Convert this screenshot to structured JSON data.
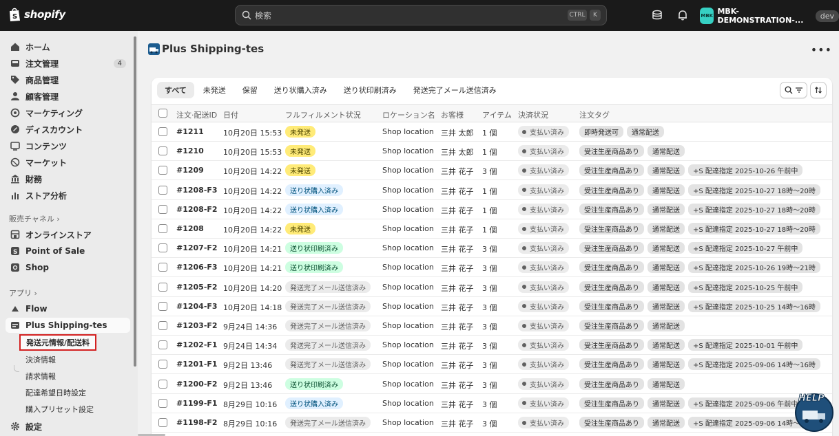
{
  "topbar": {
    "brand": "shopify",
    "search_placeholder": "検索",
    "kbd_ctrl": "CTRL",
    "kbd_k": "K",
    "store_avatar": "MBK",
    "store_name": "MBK-DEMONSTRATION-...",
    "env_badge": "dev"
  },
  "sidebar": {
    "main_items": [
      {
        "label": "ホーム",
        "icon": "home-icon"
      },
      {
        "label": "注文管理",
        "icon": "inbox-icon",
        "badge": "4"
      },
      {
        "label": "商品管理",
        "icon": "tag-icon"
      },
      {
        "label": "顧客管理",
        "icon": "person-icon"
      },
      {
        "label": "マーケティング",
        "icon": "target-icon"
      },
      {
        "label": "ディスカウント",
        "icon": "discount-icon"
      },
      {
        "label": "コンテンツ",
        "icon": "content-icon"
      },
      {
        "label": "マーケット",
        "icon": "globe-icon"
      },
      {
        "label": "財務",
        "icon": "bank-icon"
      },
      {
        "label": "ストア分析",
        "icon": "chart-icon"
      }
    ],
    "sales_channel_label": "販売チャネル",
    "channels": [
      {
        "label": "オンラインストア",
        "icon": "store-icon"
      },
      {
        "label": "Point of Sale",
        "icon": "pos-icon"
      },
      {
        "label": "Shop",
        "icon": "shop-icon"
      }
    ],
    "apps_label": "アプリ",
    "apps": [
      {
        "label": "Flow",
        "icon": "flow-icon"
      },
      {
        "label": "Plus Shipping-tes",
        "icon": "app-icon"
      }
    ],
    "app_sub_items": [
      "発送元情報/配送料",
      "決済情報",
      "請求情報",
      "配達希望日時設定",
      "購入プリセット設定"
    ],
    "settings_label": "設定"
  },
  "page": {
    "title": "Plus Shipping-tes",
    "more": "•••"
  },
  "tabs": [
    "すべて",
    "未発送",
    "保留",
    "送り状購入済み",
    "送り状印刷済み",
    "発送完了メール送信済み"
  ],
  "columns": [
    "注文·配送ID",
    "日付",
    "フルフィルメント状況",
    "ロケーション名",
    "お客様",
    "アイテム",
    "決済状況",
    "注文タグ"
  ],
  "colors": {
    "yellow": "#ffeb78",
    "blue": "#e0f0ff",
    "green": "#cdfee1",
    "gray": "#ebebeb"
  },
  "rows": [
    {
      "id": "#1211",
      "date": "10月20日 15:53",
      "status": "未発送",
      "status_type": "yellow",
      "location": "Shop location",
      "customer": "三井 太郎",
      "items": "1 個",
      "payment": "支払い済み",
      "tags": [
        "即時発送可",
        "通常配送"
      ]
    },
    {
      "id": "#1210",
      "date": "10月20日 15:53",
      "status": "未発送",
      "status_type": "yellow",
      "location": "Shop location",
      "customer": "三井 太郎",
      "items": "1 個",
      "payment": "支払い済み",
      "tags": [
        "受注生産商品あり",
        "通常配送"
      ]
    },
    {
      "id": "#1209",
      "date": "10月20日 14:22",
      "status": "未発送",
      "status_type": "yellow",
      "location": "Shop location",
      "customer": "三井 花子",
      "items": "3 個",
      "payment": "支払い済み",
      "tags": [
        "受注生産商品あり",
        "通常配送",
        "+S 配達指定 2025-10-26 午前中"
      ]
    },
    {
      "id": "#1208-F3",
      "date": "10月20日 14:22",
      "status": "送り状購入済み",
      "status_type": "blue",
      "location": "Shop location",
      "customer": "三井 花子",
      "items": "1 個",
      "payment": "支払い済み",
      "tags": [
        "受注生産商品あり",
        "通常配送",
        "+S 配達指定 2025-10-27 18時〜20時"
      ]
    },
    {
      "id": "#1208-F2",
      "date": "10月20日 14:22",
      "status": "送り状購入済み",
      "status_type": "blue",
      "location": "Shop location",
      "customer": "三井 花子",
      "items": "1 個",
      "payment": "支払い済み",
      "tags": [
        "受注生産商品あり",
        "通常配送",
        "+S 配達指定 2025-10-27 18時〜20時"
      ]
    },
    {
      "id": "#1208",
      "date": "10月20日 14:22",
      "status": "未発送",
      "status_type": "yellow",
      "location": "Shop location",
      "customer": "三井 花子",
      "items": "1 個",
      "payment": "支払い済み",
      "tags": [
        "受注生産商品あり",
        "通常配送",
        "+S 配達指定 2025-10-27 18時〜20時"
      ]
    },
    {
      "id": "#1207-F2",
      "date": "10月20日 14:21",
      "status": "送り状印刷済み",
      "status_type": "green",
      "location": "Shop location",
      "customer": "三井 花子",
      "items": "3 個",
      "payment": "支払い済み",
      "tags": [
        "受注生産商品あり",
        "通常配送",
        "+S 配達指定 2025-10-27 午前中"
      ]
    },
    {
      "id": "#1206-F3",
      "date": "10月20日 14:21",
      "status": "送り状印刷済み",
      "status_type": "green",
      "location": "Shop location",
      "customer": "三井 花子",
      "items": "3 個",
      "payment": "支払い済み",
      "tags": [
        "受注生産商品あり",
        "通常配送",
        "+S 配達指定 2025-10-26 19時〜21時"
      ]
    },
    {
      "id": "#1205-F2",
      "date": "10月20日 14:20",
      "status": "発送完了メール送信済み",
      "status_type": "gray",
      "location": "Shop location",
      "customer": "三井 花子",
      "items": "3 個",
      "payment": "支払い済み",
      "tags": [
        "受注生産商品あり",
        "通常配送",
        "+S 配達指定 2025-10-25 午前中"
      ]
    },
    {
      "id": "#1204-F3",
      "date": "10月20日 14:18",
      "status": "発送完了メール送信済み",
      "status_type": "gray",
      "location": "Shop location",
      "customer": "三井 花子",
      "items": "3 個",
      "payment": "支払い済み",
      "tags": [
        "受注生産商品あり",
        "通常配送",
        "+S 配達指定 2025-10-25 14時〜16時"
      ]
    },
    {
      "id": "#1203-F2",
      "date": "9月24日 14:36",
      "status": "発送完了メール送信済み",
      "status_type": "gray",
      "location": "Shop location",
      "customer": "三井 花子",
      "items": "3 個",
      "payment": "支払い済み",
      "tags": [
        "受注生産商品あり",
        "通常配送"
      ]
    },
    {
      "id": "#1202-F1",
      "date": "9月24日 14:34",
      "status": "発送完了メール送信済み",
      "status_type": "gray",
      "location": "Shop location",
      "customer": "三井 花子",
      "items": "3 個",
      "payment": "支払い済み",
      "tags": [
        "受注生産商品あり",
        "通常配送",
        "+S 配達指定 2025-10-01 午前中"
      ]
    },
    {
      "id": "#1201-F1",
      "date": "9月2日 13:46",
      "status": "発送完了メール送信済み",
      "status_type": "gray",
      "location": "Shop location",
      "customer": "三井 花子",
      "items": "3 個",
      "payment": "支払い済み",
      "tags": [
        "受注生産商品あり",
        "通常配送",
        "+S 配達指定 2025-09-06 14時〜16時"
      ]
    },
    {
      "id": "#1200-F2",
      "date": "9月2日 13:46",
      "status": "送り状印刷済み",
      "status_type": "green",
      "location": "Shop location",
      "customer": "三井 花子",
      "items": "3 個",
      "payment": "支払い済み",
      "tags": [
        "受注生産商品あり",
        "通常配送"
      ]
    },
    {
      "id": "#1199-F1",
      "date": "8月29日 10:16",
      "status": "送り状購入済み",
      "status_type": "blue",
      "location": "Shop location",
      "customer": "三井 花子",
      "items": "3 個",
      "payment": "支払い済み",
      "tags": [
        "受注生産商品あり",
        "通常配送",
        "+S 配達指定 2025-09-06 午前中"
      ]
    },
    {
      "id": "#1198-F2",
      "date": "8月29日 10:16",
      "status": "発送完了メール送信済み",
      "status_type": "gray",
      "location": "Shop location",
      "customer": "三井 花子",
      "items": "3 個",
      "payment": "支払い済み",
      "tags": [
        "受注生産商品あり",
        "通常配送",
        "+S 配達指定 2025-09-06 14時〜16時"
      ]
    }
  ],
  "help_label": "HELP"
}
